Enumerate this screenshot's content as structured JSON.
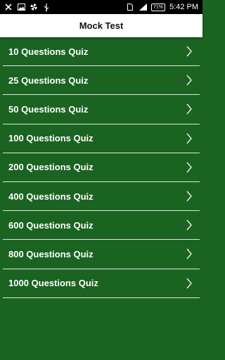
{
  "status_bar": {
    "battery": "71%",
    "time": "5:42 PM",
    "icons": [
      "close-icon",
      "image-icon",
      "pinwheel-icon",
      "usb-icon",
      "sim-icon",
      "signal-icon",
      "battery-icon"
    ]
  },
  "app_bar": {
    "title": "Mock Test"
  },
  "menu": {
    "items": [
      {
        "label": "10 Questions Quiz"
      },
      {
        "label": "25 Questions Quiz"
      },
      {
        "label": "50 Questions Quiz"
      },
      {
        "label": "100 Questions Quiz"
      },
      {
        "label": "200 Questions Quiz"
      },
      {
        "label": "400 Questions Quiz"
      },
      {
        "label": "600 Questions Quiz"
      },
      {
        "label": "800 Questions Quiz"
      },
      {
        "label": "1000 Questions Quiz"
      }
    ]
  },
  "colors": {
    "background": "#1b6321",
    "app_bar": "#ffffff",
    "divider": "#dfe7df",
    "status_bar": "#000000"
  }
}
